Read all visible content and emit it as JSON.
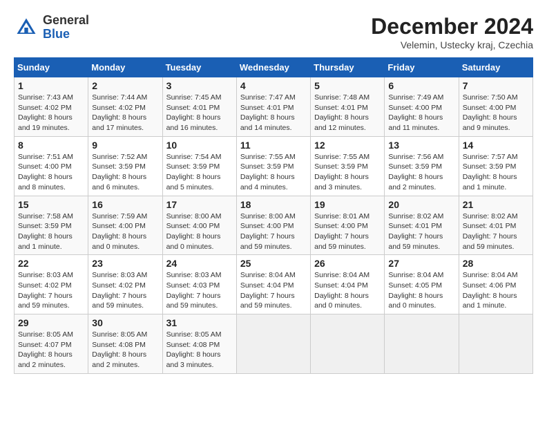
{
  "header": {
    "logo_line1": "General",
    "logo_line2": "Blue",
    "month_title": "December 2024",
    "location": "Velemin, Ustecky kraj, Czechia"
  },
  "weekdays": [
    "Sunday",
    "Monday",
    "Tuesday",
    "Wednesday",
    "Thursday",
    "Friday",
    "Saturday"
  ],
  "weeks": [
    [
      {
        "day": "1",
        "sunrise": "7:43 AM",
        "sunset": "4:02 PM",
        "daylight": "8 hours and 19 minutes."
      },
      {
        "day": "2",
        "sunrise": "7:44 AM",
        "sunset": "4:02 PM",
        "daylight": "8 hours and 17 minutes."
      },
      {
        "day": "3",
        "sunrise": "7:45 AM",
        "sunset": "4:01 PM",
        "daylight": "8 hours and 16 minutes."
      },
      {
        "day": "4",
        "sunrise": "7:47 AM",
        "sunset": "4:01 PM",
        "daylight": "8 hours and 14 minutes."
      },
      {
        "day": "5",
        "sunrise": "7:48 AM",
        "sunset": "4:01 PM",
        "daylight": "8 hours and 12 minutes."
      },
      {
        "day": "6",
        "sunrise": "7:49 AM",
        "sunset": "4:00 PM",
        "daylight": "8 hours and 11 minutes."
      },
      {
        "day": "7",
        "sunrise": "7:50 AM",
        "sunset": "4:00 PM",
        "daylight": "8 hours and 9 minutes."
      }
    ],
    [
      {
        "day": "8",
        "sunrise": "7:51 AM",
        "sunset": "4:00 PM",
        "daylight": "8 hours and 8 minutes."
      },
      {
        "day": "9",
        "sunrise": "7:52 AM",
        "sunset": "3:59 PM",
        "daylight": "8 hours and 6 minutes."
      },
      {
        "day": "10",
        "sunrise": "7:54 AM",
        "sunset": "3:59 PM",
        "daylight": "8 hours and 5 minutes."
      },
      {
        "day": "11",
        "sunrise": "7:55 AM",
        "sunset": "3:59 PM",
        "daylight": "8 hours and 4 minutes."
      },
      {
        "day": "12",
        "sunrise": "7:55 AM",
        "sunset": "3:59 PM",
        "daylight": "8 hours and 3 minutes."
      },
      {
        "day": "13",
        "sunrise": "7:56 AM",
        "sunset": "3:59 PM",
        "daylight": "8 hours and 2 minutes."
      },
      {
        "day": "14",
        "sunrise": "7:57 AM",
        "sunset": "3:59 PM",
        "daylight": "8 hours and 1 minute."
      }
    ],
    [
      {
        "day": "15",
        "sunrise": "7:58 AM",
        "sunset": "3:59 PM",
        "daylight": "8 hours and 1 minute."
      },
      {
        "day": "16",
        "sunrise": "7:59 AM",
        "sunset": "4:00 PM",
        "daylight": "8 hours and 0 minutes."
      },
      {
        "day": "17",
        "sunrise": "8:00 AM",
        "sunset": "4:00 PM",
        "daylight": "8 hours and 0 minutes."
      },
      {
        "day": "18",
        "sunrise": "8:00 AM",
        "sunset": "4:00 PM",
        "daylight": "7 hours and 59 minutes."
      },
      {
        "day": "19",
        "sunrise": "8:01 AM",
        "sunset": "4:00 PM",
        "daylight": "7 hours and 59 minutes."
      },
      {
        "day": "20",
        "sunrise": "8:02 AM",
        "sunset": "4:01 PM",
        "daylight": "7 hours and 59 minutes."
      },
      {
        "day": "21",
        "sunrise": "8:02 AM",
        "sunset": "4:01 PM",
        "daylight": "7 hours and 59 minutes."
      }
    ],
    [
      {
        "day": "22",
        "sunrise": "8:03 AM",
        "sunset": "4:02 PM",
        "daylight": "7 hours and 59 minutes."
      },
      {
        "day": "23",
        "sunrise": "8:03 AM",
        "sunset": "4:02 PM",
        "daylight": "7 hours and 59 minutes."
      },
      {
        "day": "24",
        "sunrise": "8:03 AM",
        "sunset": "4:03 PM",
        "daylight": "7 hours and 59 minutes."
      },
      {
        "day": "25",
        "sunrise": "8:04 AM",
        "sunset": "4:04 PM",
        "daylight": "7 hours and 59 minutes."
      },
      {
        "day": "26",
        "sunrise": "8:04 AM",
        "sunset": "4:04 PM",
        "daylight": "8 hours and 0 minutes."
      },
      {
        "day": "27",
        "sunrise": "8:04 AM",
        "sunset": "4:05 PM",
        "daylight": "8 hours and 0 minutes."
      },
      {
        "day": "28",
        "sunrise": "8:04 AM",
        "sunset": "4:06 PM",
        "daylight": "8 hours and 1 minute."
      }
    ],
    [
      {
        "day": "29",
        "sunrise": "8:05 AM",
        "sunset": "4:07 PM",
        "daylight": "8 hours and 2 minutes."
      },
      {
        "day": "30",
        "sunrise": "8:05 AM",
        "sunset": "4:08 PM",
        "daylight": "8 hours and 2 minutes."
      },
      {
        "day": "31",
        "sunrise": "8:05 AM",
        "sunset": "4:08 PM",
        "daylight": "8 hours and 3 minutes."
      },
      null,
      null,
      null,
      null
    ]
  ]
}
